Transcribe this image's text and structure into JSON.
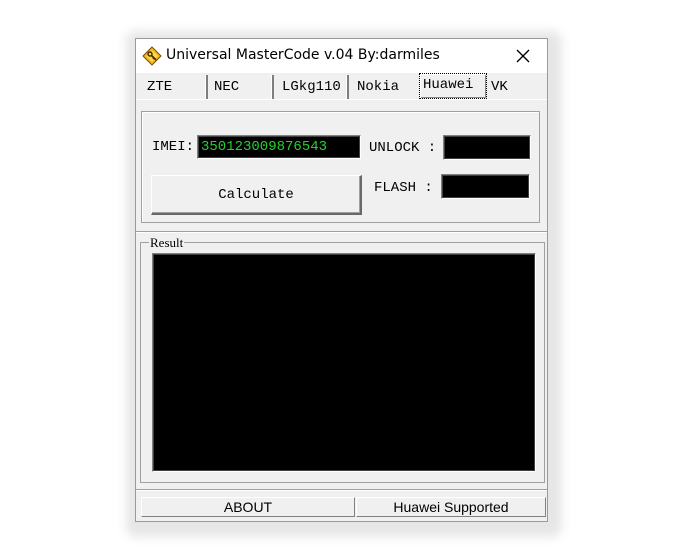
{
  "window": {
    "title": "Universal MasterCode v.04 By:darmiles"
  },
  "tabs": [
    {
      "label": "ZTE"
    },
    {
      "label": "NEC"
    },
    {
      "label": "LGkg110"
    },
    {
      "label": "Nokia"
    },
    {
      "label": "Huawei",
      "active": true
    },
    {
      "label": "VK"
    }
  ],
  "form": {
    "imei_label": "IMEI:",
    "imei_value": "350123009876543",
    "unlock_label": "UNLOCK :",
    "unlock_value": "",
    "flash_label": "FLASH :",
    "flash_value": "",
    "calculate_label": "Calculate"
  },
  "result": {
    "legend": "Result",
    "text": ""
  },
  "statusbar": {
    "about_label": "ABOUT",
    "status_text": "Huawei Supported"
  },
  "colors": {
    "field_background": "#000000",
    "imei_text": "#22d22e",
    "window_face": "#f0f0f0"
  },
  "icons": {
    "app": "diamond-key-icon",
    "close": "close-icon"
  }
}
